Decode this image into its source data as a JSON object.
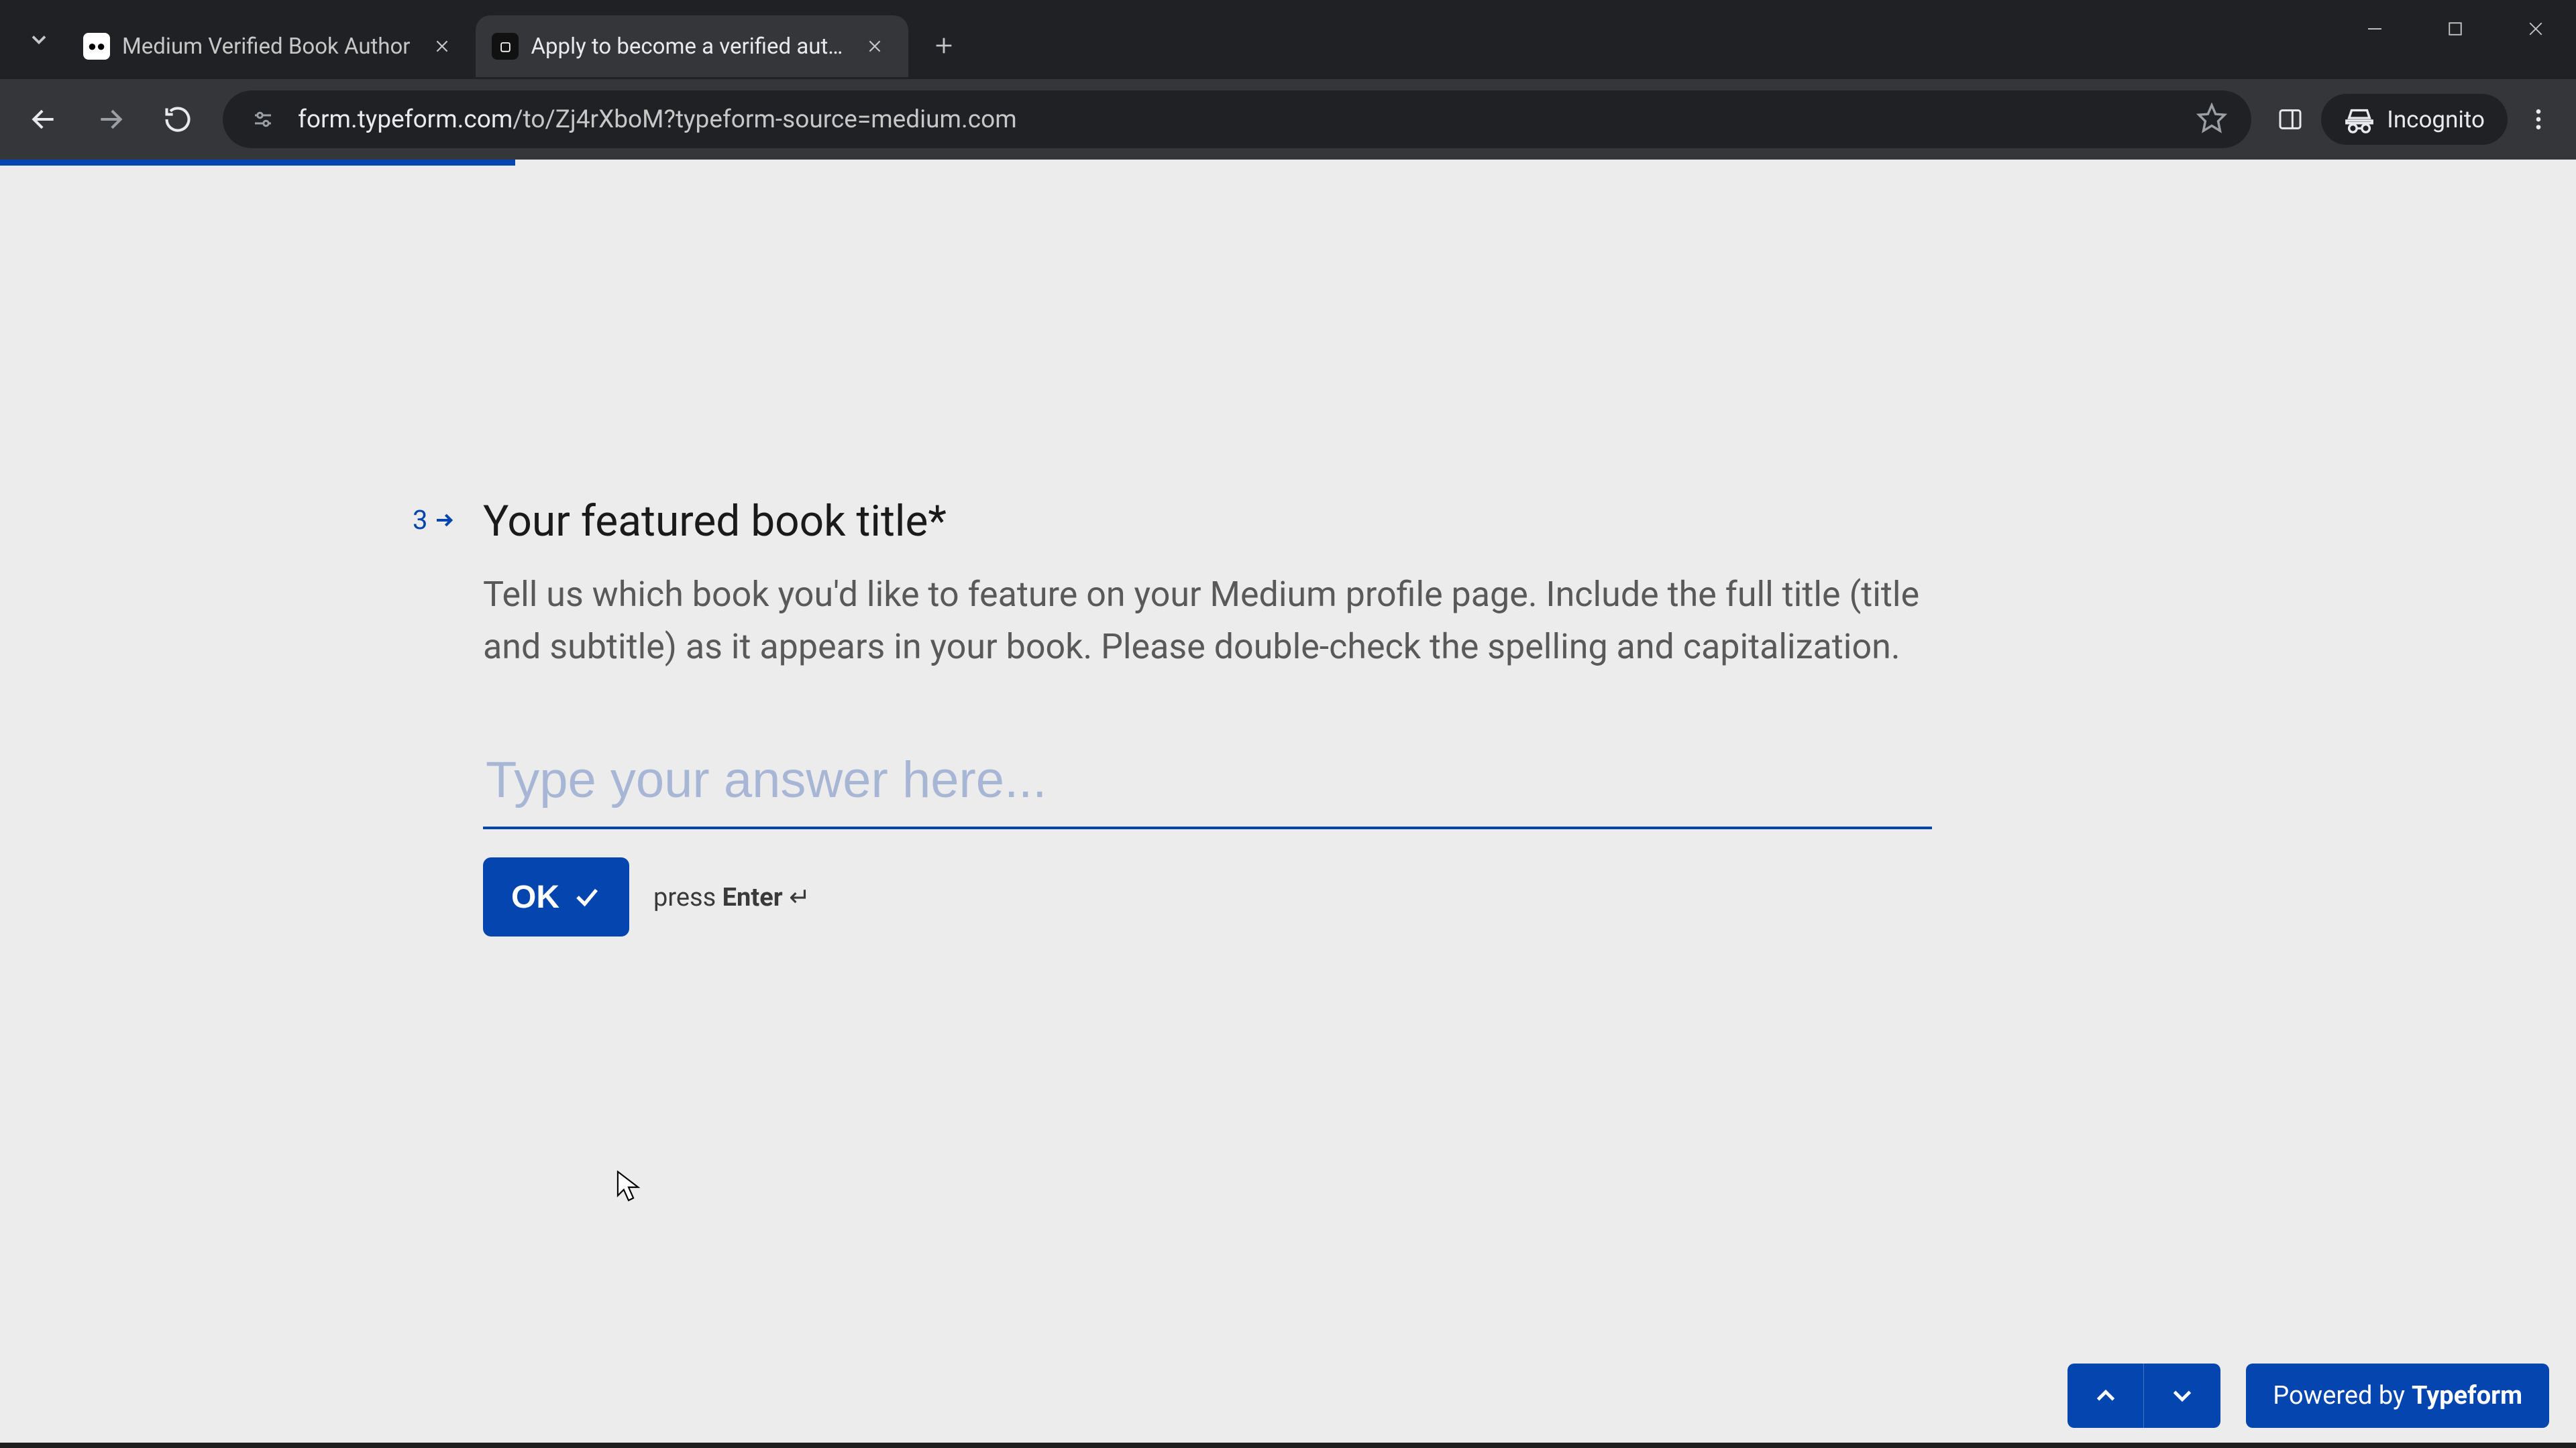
{
  "browser": {
    "tabs": [
      {
        "title": "Medium Verified Book Author",
        "active": false
      },
      {
        "title": "Apply to become a verified aut…",
        "active": true
      }
    ],
    "url_host": "form.typeform.com",
    "url_path": "/to/Zj4rXboM?typeform-source=medium.com",
    "incognito_label": "Incognito"
  },
  "form": {
    "progress_pct": 20,
    "question_number": "3",
    "title": "Your featured book title*",
    "description": "Tell us which book you'd like to feature on your Medium profile page. Include the full title (title and subtitle) as it appears in your book. Please double-check the spelling and capitalization.",
    "placeholder": "Type your answer here...",
    "value": "",
    "ok_label": "OK",
    "hint_prefix": "press ",
    "hint_key": "Enter",
    "hint_glyph": " ↵"
  },
  "footer": {
    "powered_prefix": "Powered by ",
    "powered_brand": "Typeform"
  }
}
